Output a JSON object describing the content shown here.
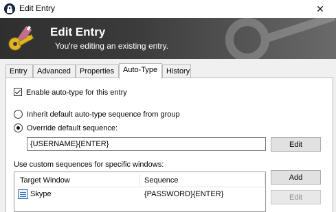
{
  "window": {
    "title": "Edit Entry",
    "close_glyph": "✕"
  },
  "banner": {
    "title": "Edit Entry",
    "subtitle": "You're editing an existing entry."
  },
  "tabs": [
    {
      "label": "Entry",
      "active": false
    },
    {
      "label": "Advanced",
      "active": false
    },
    {
      "label": "Properties",
      "active": false
    },
    {
      "label": "Auto-Type",
      "active": true
    },
    {
      "label": "History",
      "active": false
    }
  ],
  "autotype": {
    "enable_label": "Enable auto-type for this entry",
    "enable_checked": true,
    "inherit_label": "Inherit default auto-type sequence from group",
    "override_label": "Override default sequence:",
    "selected_option": "override",
    "sequence_value": "{USERNAME}{ENTER}",
    "edit_label": "Edit",
    "custom_label": "Use custom sequences for specific windows:",
    "add_label": "Add",
    "edit2_label": "Edit"
  },
  "associations": {
    "columns": [
      "Target Window",
      "Sequence"
    ],
    "rows": [
      {
        "window": "Skype",
        "sequence": "{PASSWORD}{ENTER}",
        "icon": "window-list-icon"
      }
    ]
  },
  "colors": {
    "banner_dark": "#2f2f2f",
    "accent_key": "#e2b423"
  }
}
